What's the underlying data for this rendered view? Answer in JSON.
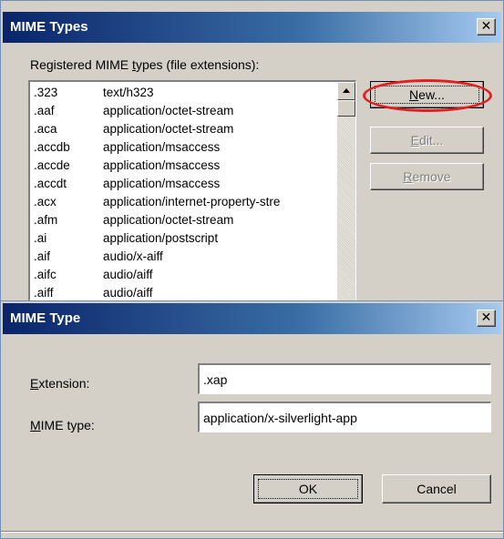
{
  "mime_types_window": {
    "title": "MIME Types",
    "close_glyph": "✕",
    "registered_label_pre": "Registered MIME ",
    "registered_label_key": "t",
    "registered_label_post": "ypes (file extensions):",
    "rows": [
      {
        "ext": ".323",
        "mime": "text/h323"
      },
      {
        "ext": ".aaf",
        "mime": "application/octet-stream"
      },
      {
        "ext": ".aca",
        "mime": "application/octet-stream"
      },
      {
        "ext": ".accdb",
        "mime": "application/msaccess"
      },
      {
        "ext": ".accde",
        "mime": "application/msaccess"
      },
      {
        "ext": ".accdt",
        "mime": "application/msaccess"
      },
      {
        "ext": ".acx",
        "mime": "application/internet-property-stre"
      },
      {
        "ext": ".afm",
        "mime": "application/octet-stream"
      },
      {
        "ext": ".ai",
        "mime": "application/postscript"
      },
      {
        "ext": ".aif",
        "mime": "audio/x-aiff"
      },
      {
        "ext": ".aifc",
        "mime": "audio/aiff"
      },
      {
        "ext": ".aiff",
        "mime": "audio/aiff"
      }
    ],
    "new_key": "N",
    "new_rest": "ew...",
    "edit_key": "E",
    "edit_rest": "dit...",
    "remove_key": "R",
    "remove_rest": "emove",
    "annotation_color": "#e02020"
  },
  "mime_type_dialog": {
    "title": "MIME Type",
    "close_glyph": "✕",
    "extension_label_key": "E",
    "extension_label_rest": "xtension:",
    "extension_value": ".xap",
    "mime_label_pre": "",
    "mime_label_key": "M",
    "mime_label_rest": "IME type:",
    "mime_value": "application/x-silverlight-app",
    "ok_label": "OK",
    "cancel_label": "Cancel"
  }
}
